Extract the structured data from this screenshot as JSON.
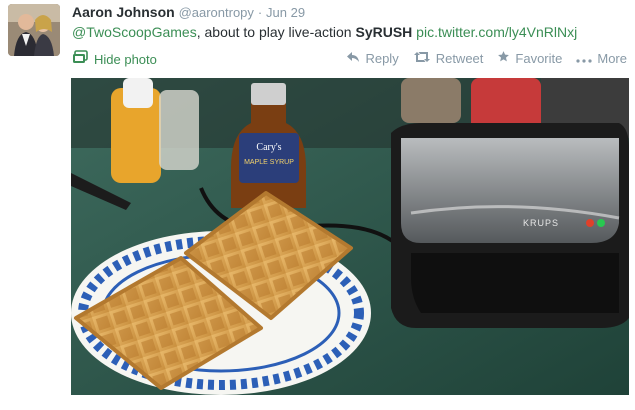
{
  "tweet": {
    "fullname": "Aaron Johnson",
    "handle": "@aarontropy",
    "separator": "·",
    "date": "Jun 29",
    "mention": "@TwoScoopGames",
    "text_mid": ", about to play live-action ",
    "bold_word": "SyRUSH",
    "photo_link": "pic.twitter.com/ly4VnRlNxj"
  },
  "media": {
    "hide_photo_label": "Hide photo",
    "syrup_brand": "Cary's",
    "syrup_label": "MAPLE SYRUP",
    "waffle_maker_brand": "KRUPS"
  },
  "actions": {
    "reply": "Reply",
    "retweet": "Retweet",
    "favorite": "Favorite",
    "more": "More"
  },
  "colors": {
    "link": "#3b8e55",
    "meta": "#8899a6",
    "text": "#292f33"
  }
}
